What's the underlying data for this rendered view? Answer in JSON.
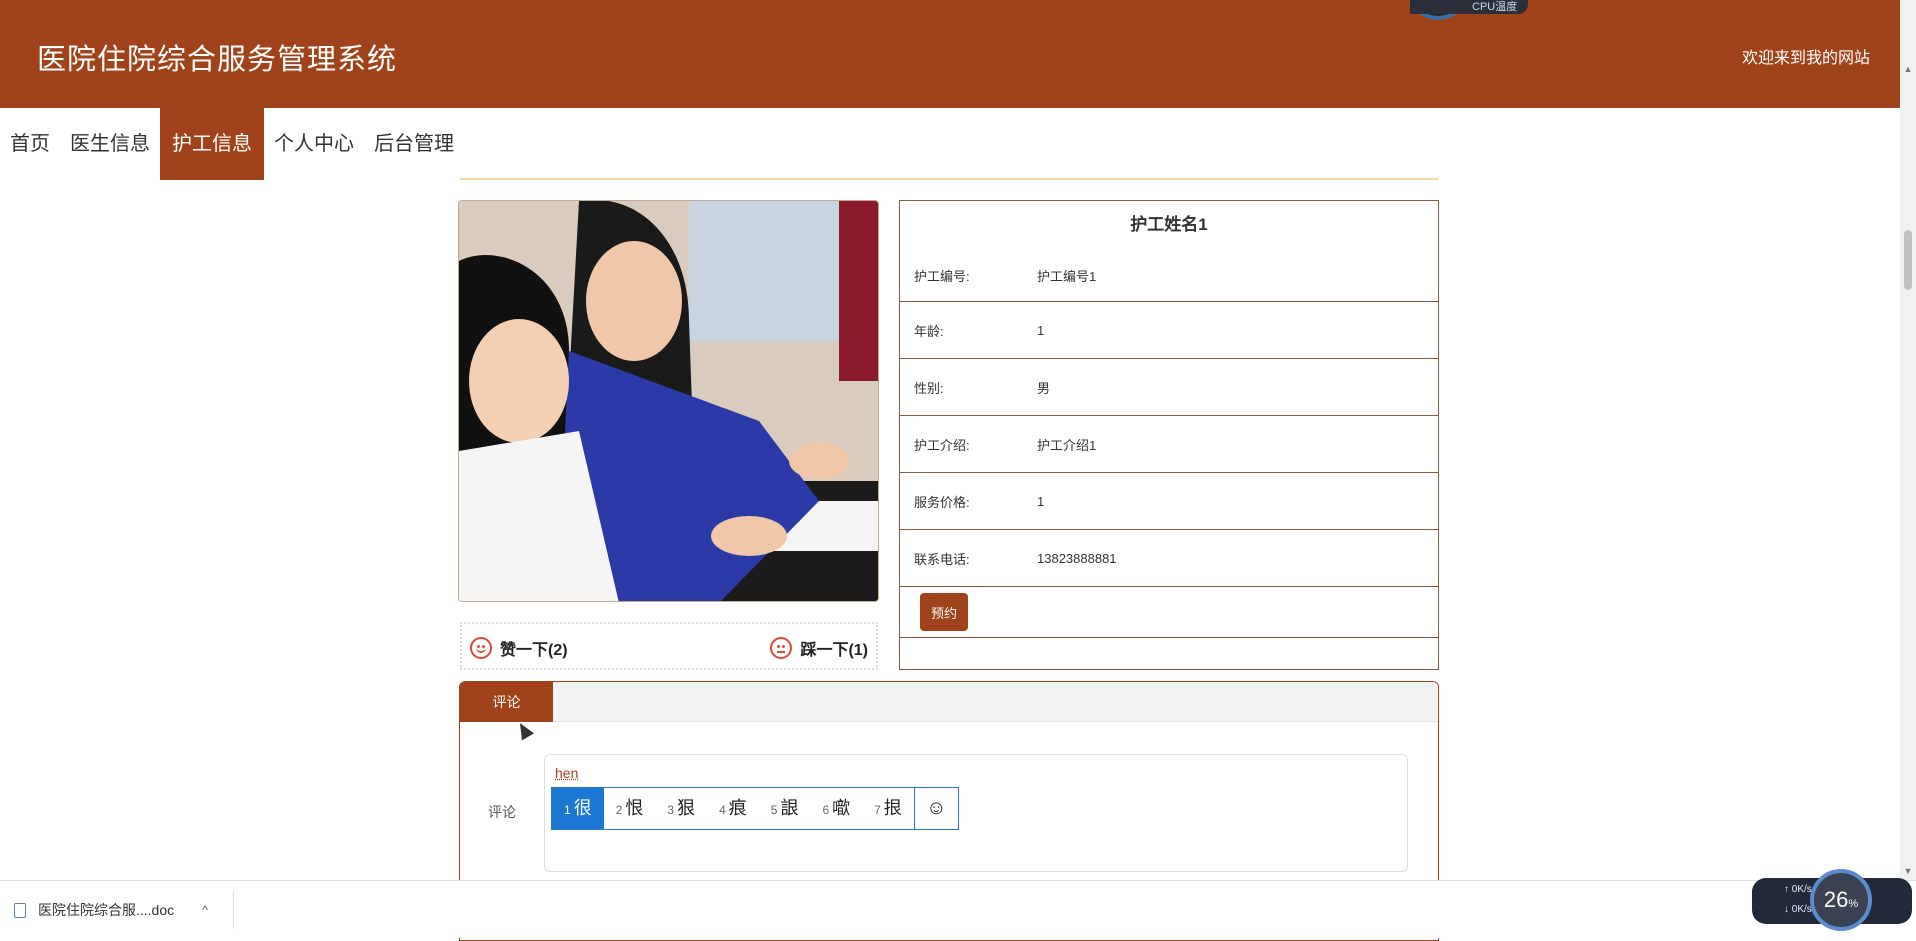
{
  "header": {
    "title": "医院住院综合服务管理系统",
    "welcome": "欢迎来到我的网站",
    "cpu_label": "CPU温度"
  },
  "nav": {
    "items": [
      "首页",
      "医生信息",
      "护工信息",
      "个人中心",
      "后台管理"
    ],
    "active_index": 2
  },
  "detail": {
    "name": "护工姓名1",
    "fields": [
      {
        "label": "护工编号:",
        "value": "护工编号1"
      },
      {
        "label": "年龄:",
        "value": "1"
      },
      {
        "label": "性别:",
        "value": "男"
      },
      {
        "label": "护工介绍:",
        "value": "护工介绍1"
      },
      {
        "label": "服务价格:",
        "value": "1"
      },
      {
        "label": "联系电话:",
        "value": "13823888881"
      }
    ],
    "book_button": "预约"
  },
  "votes": {
    "like": "赞一下(2)",
    "dislike": "踩一下(1)"
  },
  "comment": {
    "tab": "评论",
    "label": "评论",
    "ime_composing": "hen",
    "ime_candidates": [
      {
        "num": "1",
        "text": "很"
      },
      {
        "num": "2",
        "text": "恨"
      },
      {
        "num": "3",
        "text": "狠"
      },
      {
        "num": "4",
        "text": "痕"
      },
      {
        "num": "5",
        "text": "詪"
      },
      {
        "num": "6",
        "text": "噷"
      },
      {
        "num": "7",
        "text": "拫"
      }
    ],
    "ime_emoji": "☺"
  },
  "download_bar": {
    "file_name": "医院住院综合服....doc",
    "close": "✕"
  },
  "net": {
    "up": "0K/s",
    "down": "0K/s",
    "percent": "26",
    "unit": "%"
  }
}
